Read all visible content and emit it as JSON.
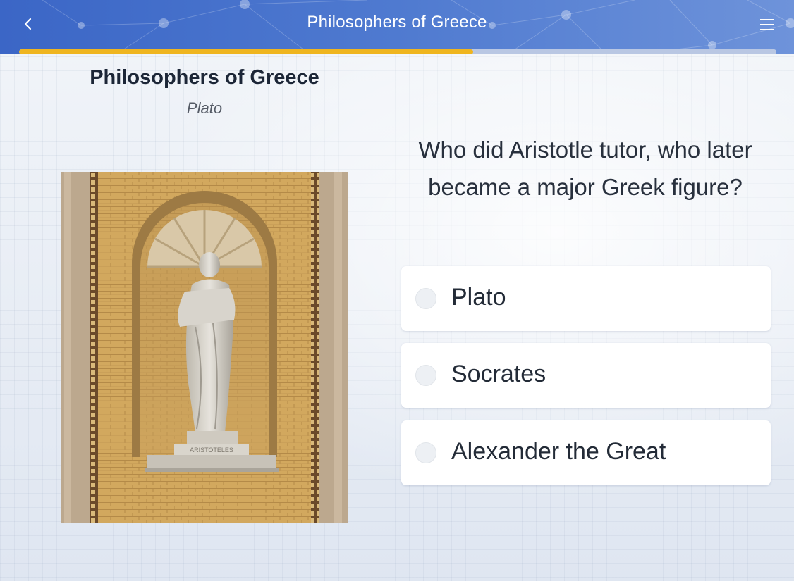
{
  "header": {
    "title": "Philosophers of Greece",
    "back_icon": "chevron-left-icon",
    "menu_icon": "hamburger-menu-icon",
    "colors": {
      "start": "#3b66c6",
      "end": "#6e93da"
    }
  },
  "progress": {
    "fraction": 0.6,
    "fill_color": "#efb51f",
    "track_color": "#b9c7e3"
  },
  "quiz": {
    "title": "Philosophers of Greece",
    "subtitle": "Plato"
  },
  "image": {
    "plaque_text": "ARISTOTELES"
  },
  "question": {
    "text": "Who did Aristotle tutor, who later became a major Greek figure?"
  },
  "options": [
    {
      "label": "Plato"
    },
    {
      "label": "Socrates"
    },
    {
      "label": "Alexander the Great"
    }
  ]
}
